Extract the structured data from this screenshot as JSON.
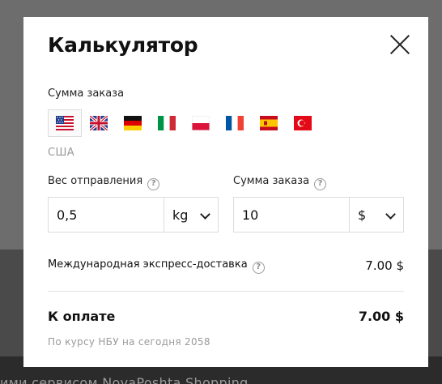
{
  "background": {
    "footer_text": "ими сервисом NovaPoshta Shopping"
  },
  "modal": {
    "title": "Калькулятор",
    "order_amount_label": "Сумма заказа",
    "flags": [
      {
        "name": "us-flag-icon",
        "selected": true
      },
      {
        "name": "uk-flag-icon",
        "selected": false
      },
      {
        "name": "de-flag-icon",
        "selected": false
      },
      {
        "name": "it-flag-icon",
        "selected": false
      },
      {
        "name": "pl-flag-icon",
        "selected": false
      },
      {
        "name": "fr-flag-icon",
        "selected": false
      },
      {
        "name": "es-flag-icon",
        "selected": false
      },
      {
        "name": "tr-flag-icon",
        "selected": false
      }
    ],
    "selected_country": "США",
    "weight": {
      "label": "Вес отправления",
      "value": "0,5",
      "unit": "kg"
    },
    "sum": {
      "label": "Сумма заказа",
      "value": "10",
      "currency": "$"
    },
    "express_delivery": {
      "label": "Международная экспресс-доставка",
      "value": "7.00 $"
    },
    "total": {
      "label": "К оплате",
      "value": "7.00 $"
    },
    "rate_note": "По курсу НБУ на сегодня 2058",
    "help_glyph": "?"
  }
}
